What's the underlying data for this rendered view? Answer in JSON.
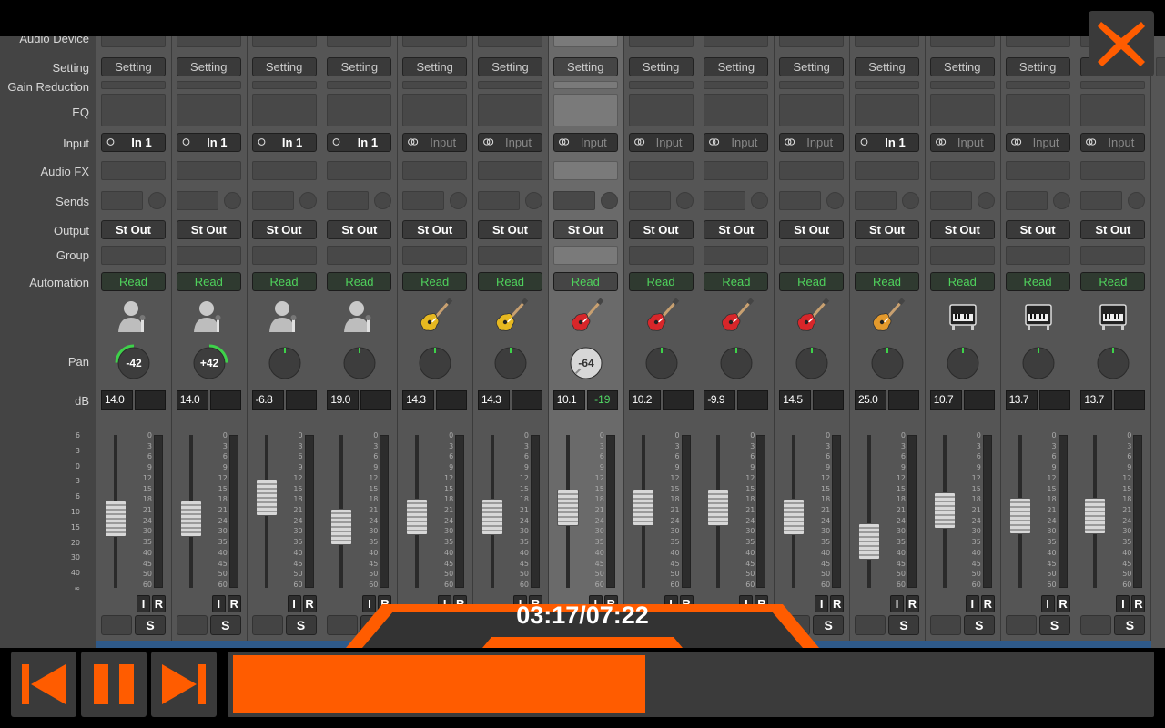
{
  "row_labels": {
    "audio_device": "Audio Device",
    "setting": "Setting",
    "gain_reduction": "Gain Reduction",
    "eq": "EQ",
    "input": "Input",
    "audio_fx": "Audio FX",
    "sends": "Sends",
    "output": "Output",
    "group": "Group",
    "automation": "Automation",
    "pan": "Pan",
    "db": "dB"
  },
  "button_text": {
    "setting": "Setting",
    "output": "St Out",
    "automation": "Read",
    "input_record": "I",
    "record": "R",
    "solo": "S"
  },
  "channels": [
    {
      "input": "In 1",
      "input_type": "mono",
      "icon": "user-icon",
      "pan": "-42",
      "pan_value": -42,
      "db": "14.0",
      "peak": "",
      "fader": 0.44
    },
    {
      "input": "In 1",
      "input_type": "mono",
      "icon": "user-icon",
      "pan": "+42",
      "pan_value": 42,
      "db": "14.0",
      "peak": "",
      "fader": 0.44
    },
    {
      "input": "In 1",
      "input_type": "mono",
      "icon": "user-icon",
      "pan": "",
      "pan_value": 0,
      "db": "-6.8",
      "peak": "",
      "fader": 0.62
    },
    {
      "input": "In 1",
      "input_type": "mono",
      "icon": "user-icon",
      "pan": "",
      "pan_value": 0,
      "db": "19.0",
      "peak": "",
      "fader": 0.37
    },
    {
      "input": "Input",
      "input_type": "stereo",
      "icon": "guitar-yellow-icon",
      "pan": "",
      "pan_value": 0,
      "db": "14.3",
      "peak": "",
      "fader": 0.45
    },
    {
      "input": "Input",
      "input_type": "stereo",
      "icon": "guitar-yellow-icon",
      "pan": "",
      "pan_value": 0,
      "db": "14.3",
      "peak": "",
      "fader": 0.45
    },
    {
      "input": "Input",
      "input_type": "stereo",
      "icon": "guitar-red-icon",
      "pan": "-64",
      "pan_value": -64,
      "db": "10.1",
      "peak": "-19",
      "fader": 0.53,
      "selected": true
    },
    {
      "input": "Input",
      "input_type": "stereo",
      "icon": "guitar-red-icon",
      "pan": "",
      "pan_value": 0,
      "db": "10.2",
      "peak": "",
      "fader": 0.53
    },
    {
      "input": "Input",
      "input_type": "stereo",
      "icon": "guitar-red-icon",
      "pan": "",
      "pan_value": 0,
      "db": "-9.9",
      "peak": "",
      "fader": 0.53
    },
    {
      "input": "Input",
      "input_type": "stereo",
      "icon": "guitar-red-icon",
      "pan": "",
      "pan_value": 0,
      "db": "14.5",
      "peak": "",
      "fader": 0.45
    },
    {
      "input": "In 1",
      "input_type": "mono",
      "icon": "guitar-orange-icon",
      "pan": "",
      "pan_value": 0,
      "db": "25.0",
      "peak": "",
      "fader": 0.24
    },
    {
      "input": "Input",
      "input_type": "stereo",
      "icon": "piano-icon",
      "pan": "",
      "pan_value": 0,
      "db": "10.7",
      "peak": "",
      "fader": 0.51
    },
    {
      "input": "Input",
      "input_type": "stereo",
      "icon": "piano-icon",
      "pan": "",
      "pan_value": 0,
      "db": "13.7",
      "peak": "",
      "fader": 0.46
    },
    {
      "input": "Input",
      "input_type": "stereo",
      "icon": "piano-icon",
      "pan": "",
      "pan_value": 0,
      "db": "13.7",
      "peak": "",
      "fader": 0.46
    }
  ],
  "fader_scale": [
    "0",
    "3",
    "6",
    "9",
    "12",
    "15",
    "18",
    "21",
    "24",
    "30",
    "35",
    "40",
    "45",
    "50",
    "60"
  ],
  "left_scale": [
    "6",
    "3",
    "0",
    "3",
    "6",
    "10",
    "15",
    "20",
    "30",
    "40",
    "∞"
  ],
  "player": {
    "time": "03:17/07:22",
    "progress": 0.45,
    "colors": {
      "accent": "#ff5c00",
      "panel": "#3a3a3a",
      "automation_green": "#4fd25c",
      "pan_green": "#3ed24a"
    }
  }
}
